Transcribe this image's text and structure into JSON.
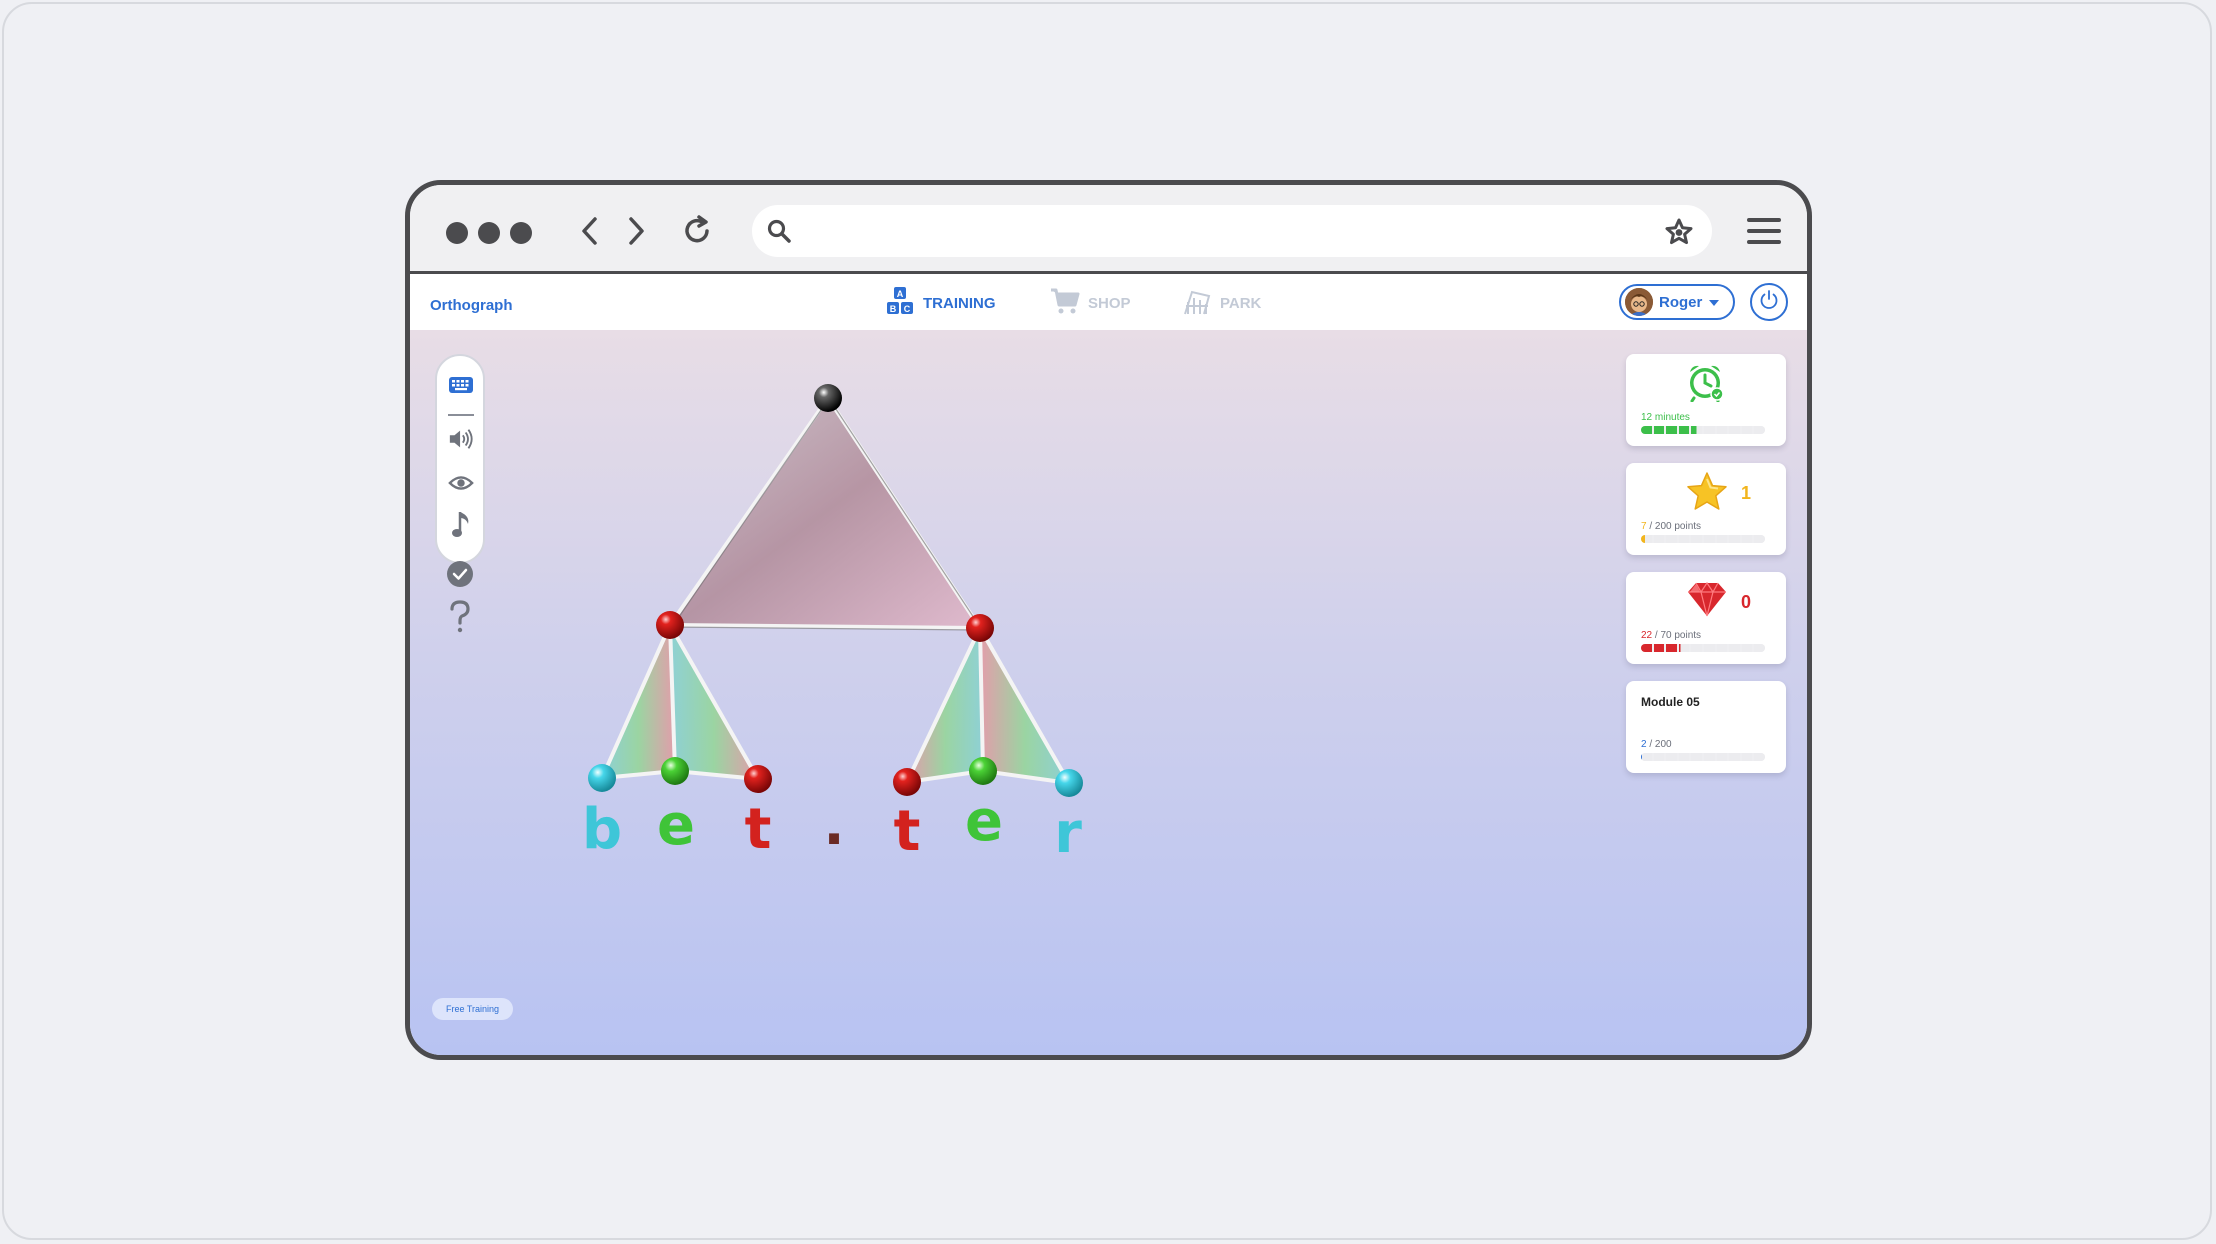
{
  "app": {
    "brand": "Orthograph"
  },
  "nav": {
    "training": "TRAINING",
    "shop": "SHOP",
    "park": "PARK"
  },
  "user": {
    "name": "Roger"
  },
  "url": {
    "value": ""
  },
  "toolbar": {
    "icons": [
      "keyboard-icon",
      "speaker-icon",
      "eye-icon",
      "music-note-icon",
      "check-circle-icon",
      "question-icon"
    ]
  },
  "cards": {
    "time": {
      "label": "12 minutes",
      "progress": 0.45,
      "color": "#3cbf4a"
    },
    "stars": {
      "count": "1",
      "current": "7",
      "label_rest": " / 200 points",
      "progress": 0.035,
      "color": "#f2b51d"
    },
    "gems": {
      "count": "0",
      "current": "22",
      "label_rest": " / 70 points",
      "progress": 0.314,
      "color": "#d8272d"
    },
    "module": {
      "title": "Module 05",
      "current": "2",
      "label_rest": " / 200",
      "progress": 0.01,
      "color": "#2e6fd3"
    }
  },
  "word": {
    "letters": [
      {
        "char": "b",
        "color": "#3ec6d8"
      },
      {
        "char": "e",
        "color": "#3fc438"
      },
      {
        "char": "t",
        "color": "#d3221e"
      },
      {
        "char": ".",
        "color": "#6a2a24"
      },
      {
        "char": "t",
        "color": "#d3221e"
      },
      {
        "char": "e",
        "color": "#3fc438"
      },
      {
        "char": "r",
        "color": "#3ec6d8"
      }
    ]
  },
  "footer": {
    "mode": "Free Training"
  }
}
